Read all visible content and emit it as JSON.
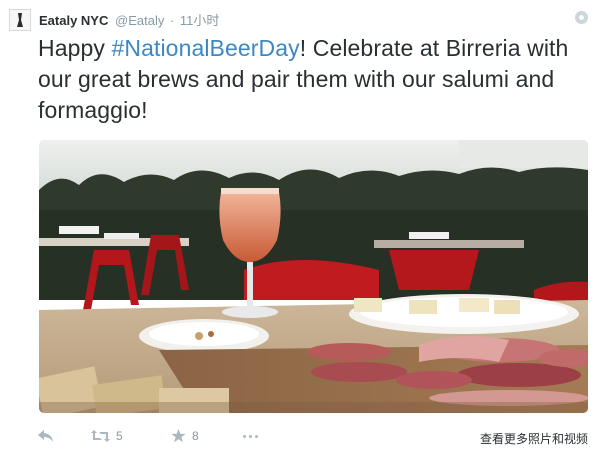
{
  "tweet": {
    "display_name": "Eataly NYC",
    "handle": "@Eataly",
    "separator": "·",
    "time": "11小时",
    "text_prefix": "Happy ",
    "hashtag": "#NationalBeerDay",
    "text_suffix": "! Celebrate at Birreria with our great brews and pair them with our salumi and formaggio!"
  },
  "actions": {
    "retweet_count": "5",
    "favorite_count": "8",
    "media_link": "查看更多照片和视频"
  },
  "icons": {
    "reply": "reply-icon",
    "retweet": "retweet-icon",
    "favorite": "star-icon",
    "more": "more-icon",
    "settings": "gear-icon"
  },
  "colors": {
    "hashtag": "#3b88c3",
    "muted": "#8899a6",
    "text": "#292f33"
  }
}
